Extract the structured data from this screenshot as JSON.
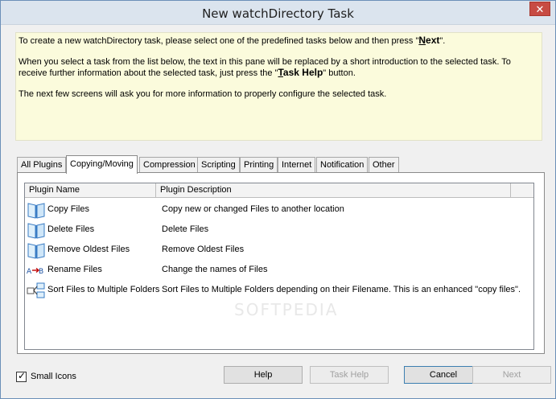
{
  "window": {
    "title": "New watchDirectory Task",
    "close_glyph": "✕"
  },
  "intro": {
    "p1_before": "To create a new watchDirectory task, please select one of the predefined tasks below and then press \"",
    "p1_key_underlined": "N",
    "p1_key_rest": "ext",
    "p1_after": "\".",
    "p2_before": "When you select a task from the list below, the text in this pane will be replaced by a short introduction to the selected task. To receive further information about the selected task, just press the \"",
    "p2_key_underlined": "T",
    "p2_key_rest": "ask Help",
    "p2_after": "\" button.",
    "p3": "The next few screens will ask you for more information to properly configure the selected task."
  },
  "tabs": [
    {
      "label": "All Plugins"
    },
    {
      "label": "Copying/Moving"
    },
    {
      "label": "Compression"
    },
    {
      "label": "Scripting"
    },
    {
      "label": "Printing"
    },
    {
      "label": "Internet"
    },
    {
      "label": "Notification"
    },
    {
      "label": "Other"
    }
  ],
  "active_tab": "Copying/Moving",
  "list": {
    "columns": [
      "Plugin Name",
      "Plugin Description"
    ],
    "rows": [
      {
        "name": "Copy Files",
        "desc": "Copy new or changed Files to another location",
        "icon": "book-icon"
      },
      {
        "name": "Delete Files",
        "desc": "Delete Files",
        "icon": "book-icon"
      },
      {
        "name": "Remove Oldest Files",
        "desc": "Remove Oldest Files",
        "icon": "book-icon"
      },
      {
        "name": "Rename Files",
        "desc": "Change the names of Files",
        "icon": "rename-icon"
      },
      {
        "name": "Sort Files to Multiple Folders",
        "desc": "Sort Files to Multiple Folders depending on their Filename. This is an enhanced \"copy files\".",
        "icon": "sort-icon"
      }
    ]
  },
  "watermark": "SOFTPEDIA",
  "options": {
    "small_icons_label": "Small Icons",
    "small_icons_checked": true,
    "check_glyph": "✓"
  },
  "buttons": {
    "help": "Help",
    "task_help": "Task Help",
    "cancel": "Cancel",
    "next": "Next"
  },
  "colors": {
    "intro_bg": "#fbfbdc",
    "close_bg": "#c74b43",
    "titlebar_bg": "#dbe4ee"
  }
}
